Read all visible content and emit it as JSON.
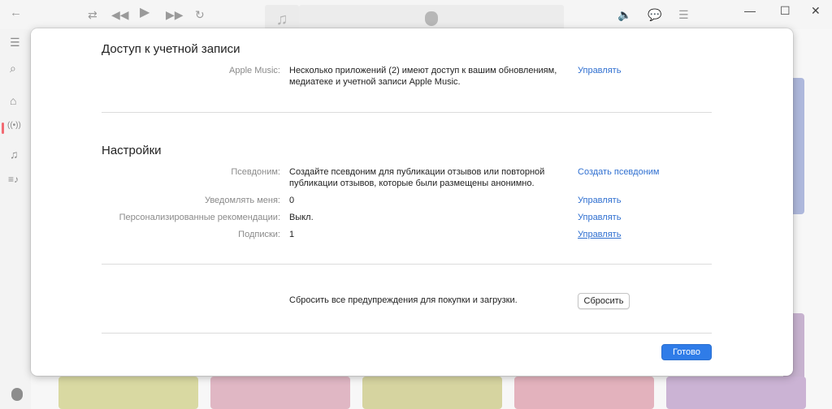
{
  "window": {
    "back_icon": "back-arrow-icon",
    "shuffle_icon": "shuffle-icon",
    "rewind_icon": "rewind-icon",
    "play_icon": "play-icon",
    "forward_icon": "fast-forward-icon",
    "repeat_icon": "repeat-icon",
    "volume_icon": "speaker-icon",
    "lyrics_icon": "lyrics-icon",
    "queue_icon": "queue-list-icon",
    "minimize_glyph": "—",
    "maximize_glyph": "☐",
    "close_glyph": "✕"
  },
  "sidebar": {
    "menu_glyph": "☰",
    "search_glyph": "⌕",
    "home_glyph": "⌂",
    "radio_glyph": "((•))",
    "library_glyph": "♫",
    "playlist_glyph": "≡♪"
  },
  "dialog": {
    "account_access": {
      "title": "Доступ к учетной записи",
      "rows": [
        {
          "label": "Apple Music:",
          "value": "Несколько приложений (2) имеют доступ к вашим обновлениям, медиатеке и учетной записи Apple Music.",
          "action": "Управлять"
        }
      ]
    },
    "settings": {
      "title": "Настройки",
      "rows": [
        {
          "label": "Псевдоним:",
          "value": "Создайте псевдоним для публикации отзывов или повторной публикации отзывов, которые были размещены анонимно.",
          "action": "Создать псевдоним"
        },
        {
          "label": "Уведомлять меня:",
          "value": "0",
          "action": "Управлять"
        },
        {
          "label": "Персонализированные рекомендации:",
          "value": "Выкл.",
          "action": "Управлять"
        },
        {
          "label": "Подписки:",
          "value": "1",
          "action": "Управлять"
        }
      ]
    },
    "reset": {
      "text": "Сбросить все предупреждения для покупки и загрузки.",
      "button": "Сбросить"
    },
    "done_button": "Готово"
  },
  "colors": {
    "link": "#2f6fd0",
    "primary_button": "#2f7ce8",
    "active_indicator": "#f26b73"
  }
}
